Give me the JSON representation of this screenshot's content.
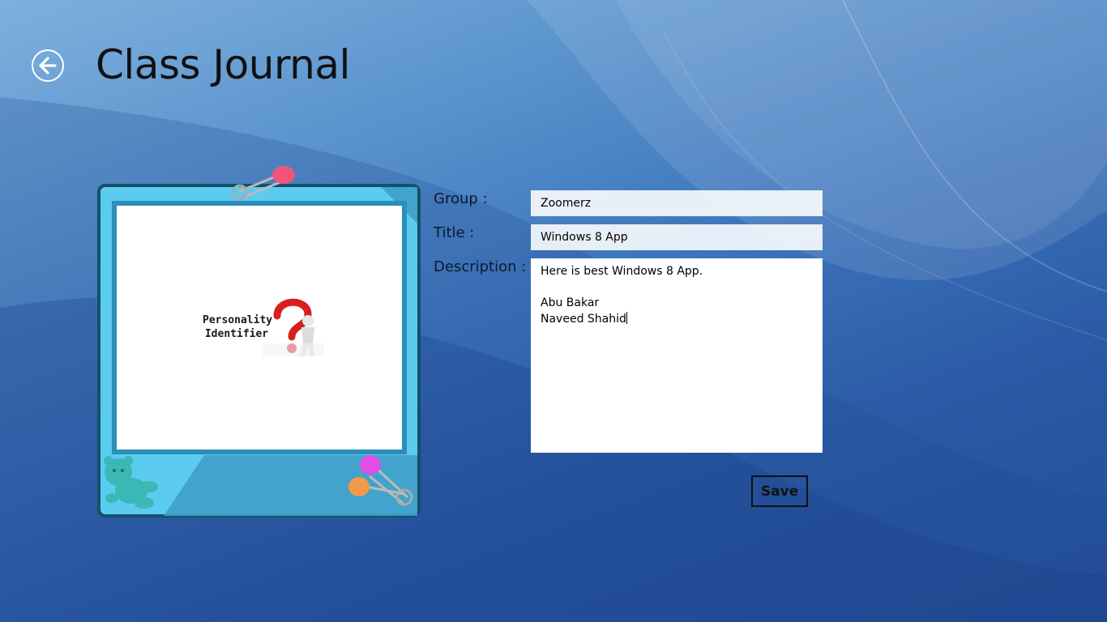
{
  "app": {
    "title": "Class Journal"
  },
  "header": {
    "back_icon": "back-arrow-icon"
  },
  "photo": {
    "logo_line1": "Personality",
    "logo_line2": "Identifier"
  },
  "form": {
    "group": {
      "label": "Group :",
      "value": "Zoomerz"
    },
    "title": {
      "label": "Title :",
      "value": "Windows 8 App"
    },
    "description": {
      "label": "Description :",
      "lines": [
        "Here is best Windows 8 App.",
        "",
        "Abu Bakar",
        "Naveed Shahid"
      ]
    },
    "save_label": "Save"
  },
  "colors": {
    "frame_fill": "#5ccbf0",
    "frame_border": "#14506b",
    "pin_pink": "#f2557a",
    "pin_magenta": "#e04ee6",
    "pin_orange": "#f09a4a",
    "bear": "#3ab8b6"
  }
}
